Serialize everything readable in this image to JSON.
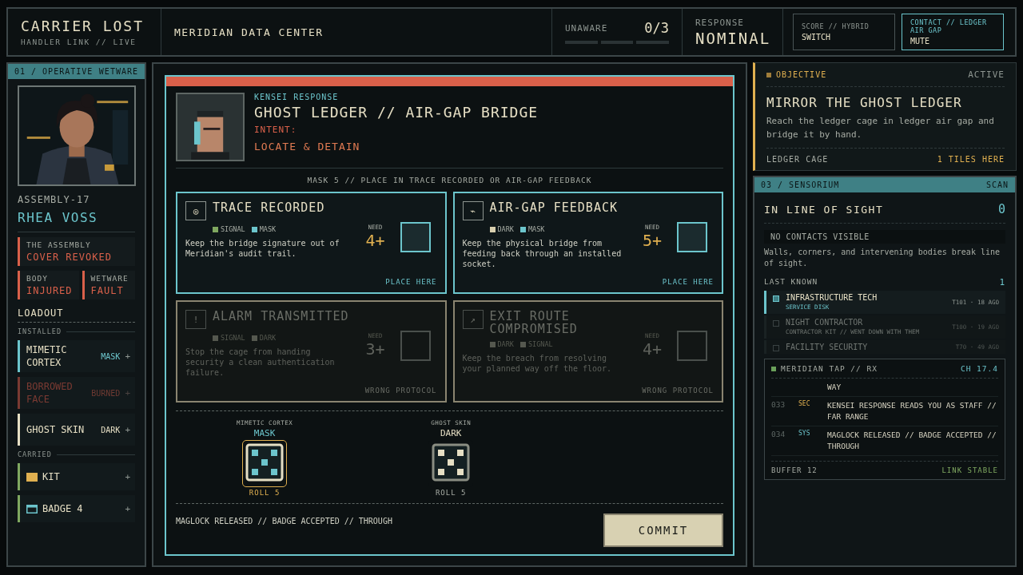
{
  "header": {
    "title": "CARRIER LOST",
    "subtitle": "HANDLER LINK // LIVE",
    "location": "MERIDIAN DATA CENTER",
    "awareness": {
      "label": "UNAWARE",
      "count": "0/3"
    },
    "response": {
      "label": "RESPONSE",
      "value": "NOMINAL"
    },
    "toggles": [
      {
        "label": "SCORE // HYBRID",
        "value": "SWITCH",
        "selected": false
      },
      {
        "label": "CONTACT // LEDGER AIR GAP",
        "value": "MUTE",
        "selected": true
      }
    ]
  },
  "operative": {
    "header": "01 / OPERATIVE",
    "tag": "WETWARE",
    "assembly": "ASSEMBLY-17",
    "name": "RHEA VOSS",
    "statuses": [
      {
        "label": "THE ASSEMBLY",
        "value": "COVER REVOKED"
      },
      {
        "label": "BODY",
        "value": "INJURED"
      },
      {
        "label": "WETWARE",
        "value": "FAULT"
      }
    ],
    "loadout_title": "LOADOUT",
    "installed_label": "INSTALLED",
    "installed": [
      {
        "name": "MIMETIC CORTEX",
        "tag": "MASK",
        "action": "+",
        "burned": false,
        "color": "#6cc5cc"
      },
      {
        "name": "BORROWED FACE",
        "tag": "BURNED",
        "action": "+",
        "burned": true,
        "color": "#7a3a32"
      },
      {
        "name": "GHOST SKIN",
        "tag": "DARK",
        "action": "+",
        "burned": false,
        "color": "#e6dfc4"
      }
    ],
    "carried_label": "CARRIED",
    "carried": [
      {
        "kind": "kit",
        "name": "KIT",
        "action": "+"
      },
      {
        "kind": "badge",
        "name": "BADGE 4",
        "action": "+"
      }
    ]
  },
  "encounter": {
    "label": "KENSEI RESPONSE",
    "title": "GHOST LEDGER // AIR-GAP BRIDGE",
    "intent_label": "INTENT:",
    "intent": "LOCATE & DETAIN",
    "instruction": "MASK 5 // PLACE IN TRACE RECORDED OR AIR-GAP FEEDBACK",
    "slots": [
      {
        "glyph": "◎",
        "title": "TRACE RECORDED",
        "tags": [
          {
            "label": "SIGNAL",
            "color": "#7fa860"
          },
          {
            "label": "MASK",
            "color": "#6cc5cc"
          }
        ],
        "text": "Keep the bridge signature out of Meridian's audit trail.",
        "need_label": "NEED",
        "need": "4+",
        "footer": "PLACE HERE",
        "available": true
      },
      {
        "glyph": "⌁",
        "title": "AIR-GAP FEEDBACK",
        "tags": [
          {
            "label": "DARK",
            "color": "#d8cfae"
          },
          {
            "label": "MASK",
            "color": "#6cc5cc"
          }
        ],
        "text": "Keep the physical bridge from feeding back through an installed socket.",
        "need_label": "NEED",
        "need": "5+",
        "footer": "PLACE HERE",
        "available": true
      },
      {
        "glyph": "!",
        "title": "ALARM TRANSMITTED",
        "tags": [
          {
            "label": "SIGNAL",
            "color": "#55584f"
          },
          {
            "label": "DARK",
            "color": "#55584f"
          }
        ],
        "text": "Stop the cage from handing security a clean authentication failure.",
        "need_label": "NEED",
        "need": "3+",
        "footer": "WRONG PROTOCOL",
        "available": false
      },
      {
        "glyph": "↗",
        "title": "EXIT ROUTE COMPROMISED",
        "tags": [
          {
            "label": "DARK",
            "color": "#55584f"
          },
          {
            "label": "SIGNAL",
            "color": "#55584f"
          }
        ],
        "text": "Keep the breach from resolving your planned way off the floor.",
        "need_label": "NEED",
        "need": "4+",
        "footer": "WRONG PROTOCOL",
        "available": false
      }
    ],
    "dice": [
      {
        "source": "MIMETIC CORTEX",
        "tag": "MASK",
        "roll": "ROLL 5",
        "selected": true,
        "color": "#6cc5cc"
      },
      {
        "source": "GHOST SKIN",
        "tag": "DARK",
        "roll": "ROLL 5",
        "selected": false,
        "color": "#e6dfc4"
      }
    ],
    "log_line": "MAGLOCK RELEASED // BADGE ACCEPTED // THROUGH",
    "commit": "COMMIT"
  },
  "objective": {
    "label": "OBJECTIVE",
    "status": "ACTIVE",
    "title": "MIRROR THE GHOST LEDGER",
    "text": "Reach the ledger cage in ledger air gap and bridge it by hand.",
    "location": "LEDGER CAGE",
    "distance": "1 TILES HERE"
  },
  "sensorium": {
    "header": "03 / SENSORIUM",
    "tag": "SCAN",
    "los_label": "IN LINE OF SIGHT",
    "los_count": "0",
    "empty": "NO CONTACTS VISIBLE",
    "note": "Walls, corners, and intervening bodies break line of sight.",
    "last_known_label": "LAST KNOWN",
    "last_known_count": "1",
    "contacts": [
      {
        "name": "INFRASTRUCTURE TECH",
        "detail": "SERVICE DISK",
        "time": "T101 · 18 AGO",
        "selected": true
      },
      {
        "name": "NIGHT CONTRACTOR",
        "detail": "CONTRACTOR KIT // WENT DOWN WITH THEM",
        "time": "T100 · 19 AGO",
        "selected": false
      },
      {
        "name": "FACILITY SECURITY",
        "time": "T70 · 49 AGO",
        "selected": false
      }
    ]
  },
  "tap": {
    "title": "MERIDIAN TAP // RX",
    "channel": "CH 17.4",
    "entries": [
      {
        "text": "WAY"
      },
      {
        "id": "033",
        "kind": "sec",
        "source": "SEC",
        "text": "KENSEI RESPONSE READS YOU AS STAFF // FAR RANGE"
      },
      {
        "id": "034",
        "kind": "sys",
        "source": "SYS",
        "text": "MAGLOCK RELEASED // BADGE ACCEPTED // THROUGH"
      }
    ],
    "buffer": "BUFFER 12",
    "link": "LINK STABLE"
  }
}
